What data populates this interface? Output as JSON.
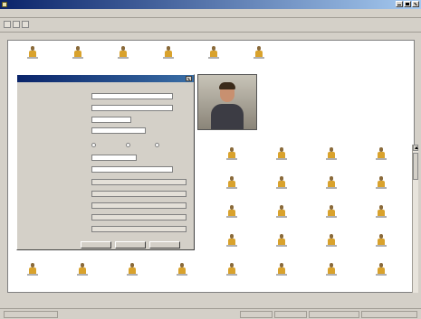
{
  "window": {
    "title": ""
  },
  "menu": {
    "items": [
      "",
      "",
      "",
      "",
      "",
      "",
      "",
      "",
      ""
    ]
  },
  "toolbar": {
    "label": ""
  },
  "contacts": {
    "top_row": [
      "",
      "",
      "",
      "",
      "",
      ""
    ],
    "grid": [
      "",
      "",
      "",
      "",
      "",
      "",
      "",
      "",
      "",
      "",
      "",
      "",
      "",
      "",
      "",
      "",
      "",
      "",
      "",
      "",
      "",
      "",
      "",
      "",
      "",
      "",
      "",
      "",
      "",
      "",
      "",
      "",
      "",
      "",
      "",
      "",
      "",
      "",
      "",
      ""
    ]
  },
  "dialog": {
    "title": "",
    "fields": [
      {
        "label": "",
        "value": ""
      },
      {
        "label": "",
        "value": ""
      },
      {
        "label": "",
        "value": ""
      },
      {
        "label": "",
        "value": ""
      },
      {
        "label": "",
        "value": ""
      },
      {
        "label": "",
        "value": ""
      },
      {
        "label": "",
        "value": ""
      },
      {
        "label": "",
        "value": ""
      },
      {
        "label": "",
        "value": ""
      },
      {
        "label": "",
        "value": ""
      },
      {
        "label": "",
        "value": ""
      },
      {
        "label": "",
        "value": ""
      }
    ],
    "buttons": [
      "",
      "",
      ""
    ]
  },
  "page_indicator": "",
  "status": {
    "panes": [
      "",
      "",
      "",
      "",
      ""
    ]
  },
  "icons": {
    "app": "contacts-app-icon",
    "contact": "person-icon",
    "window_controls": [
      "minimize-icon",
      "maximize-icon",
      "close-icon"
    ],
    "scroll": "arrow-up-icon"
  },
  "colors": {
    "title_bar": "#0a246a",
    "person_body": "#d9a22c",
    "window_face": "#d4d0c8"
  }
}
